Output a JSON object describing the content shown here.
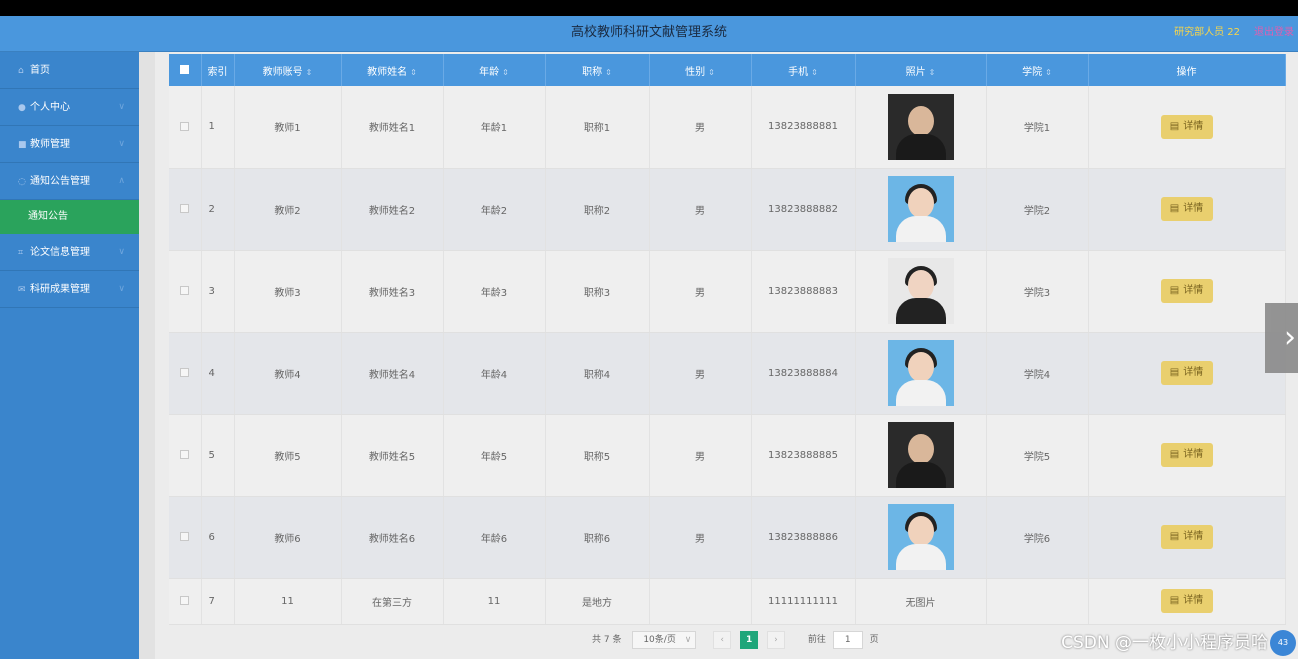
{
  "header": {
    "title": "高校教师科研文献管理系统",
    "user": "研究部人员 22",
    "logout": "退出登录"
  },
  "sidebar": {
    "items": [
      {
        "label": "首页",
        "icon": "home-icon",
        "glyph": "⌂"
      },
      {
        "label": "个人中心",
        "icon": "user-icon",
        "glyph": "●",
        "arrow": "∨"
      },
      {
        "label": "教师管理",
        "icon": "chat-icon",
        "glyph": "■",
        "arrow": "∨"
      },
      {
        "label": "通知公告管理",
        "icon": "bell-icon",
        "glyph": "◌",
        "arrow": "∧"
      },
      {
        "label": "通知公告",
        "sub": true
      },
      {
        "label": "论文信息管理",
        "icon": "crop-icon",
        "glyph": "⌗",
        "arrow": "∨"
      },
      {
        "label": "科研成果管理",
        "icon": "mail-icon",
        "glyph": "✉",
        "arrow": "∨"
      }
    ]
  },
  "table": {
    "columns": [
      "索引",
      "教师账号",
      "教师姓名",
      "年龄",
      "职称",
      "性别",
      "手机",
      "照片",
      "学院",
      "操作"
    ],
    "sort_glyph": "⇕",
    "detail_label": "详情",
    "detail_icon_glyph": "▤",
    "rows": [
      {
        "index": "1",
        "account": "教师1",
        "name": "教师姓名1",
        "age": "年龄1",
        "title": "职称1",
        "gender": "男",
        "phone": "13823888881",
        "photo": "dark",
        "photo_text": "",
        "college": "学院1"
      },
      {
        "index": "2",
        "account": "教师2",
        "name": "教师姓名2",
        "age": "年龄2",
        "title": "职称2",
        "gender": "男",
        "phone": "13823888882",
        "photo": "blue",
        "photo_text": "",
        "college": "学院2"
      },
      {
        "index": "3",
        "account": "教师3",
        "name": "教师姓名3",
        "age": "年龄3",
        "title": "职称3",
        "gender": "男",
        "phone": "13823888883",
        "photo": "grey",
        "photo_text": "",
        "college": "学院3"
      },
      {
        "index": "4",
        "account": "教师4",
        "name": "教师姓名4",
        "age": "年龄4",
        "title": "职称4",
        "gender": "男",
        "phone": "13823888884",
        "photo": "blue",
        "photo_text": "",
        "college": "学院4"
      },
      {
        "index": "5",
        "account": "教师5",
        "name": "教师姓名5",
        "age": "年龄5",
        "title": "职称5",
        "gender": "男",
        "phone": "13823888885",
        "photo": "dark",
        "photo_text": "",
        "college": "学院5"
      },
      {
        "index": "6",
        "account": "教师6",
        "name": "教师姓名6",
        "age": "年龄6",
        "title": "职称6",
        "gender": "男",
        "phone": "13823888886",
        "photo": "blue",
        "photo_text": "",
        "college": "学院6"
      },
      {
        "index": "7",
        "account": "11",
        "name": "在第三方",
        "age": "11",
        "title": "是地方",
        "gender": "",
        "phone": "11111111111",
        "photo": "none",
        "photo_text": "无图片",
        "college": ""
      }
    ]
  },
  "pager": {
    "total": "共 7 条",
    "size": "10条/页",
    "prev": "‹",
    "current": "1",
    "next": "›",
    "goto_label": "前往",
    "goto_value": "1",
    "page_label": "页",
    "dropdown_glyph": "∨"
  },
  "next_arrow": "›",
  "watermark": "CSDN @一枚小小程序员哈",
  "badge": "43",
  "colors": {
    "header": "#4a97dd",
    "sidebar": "#3a85cc",
    "active": "#2aa35c",
    "detail_button": "#e9cf6e",
    "pager_current": "#1fa67a"
  }
}
